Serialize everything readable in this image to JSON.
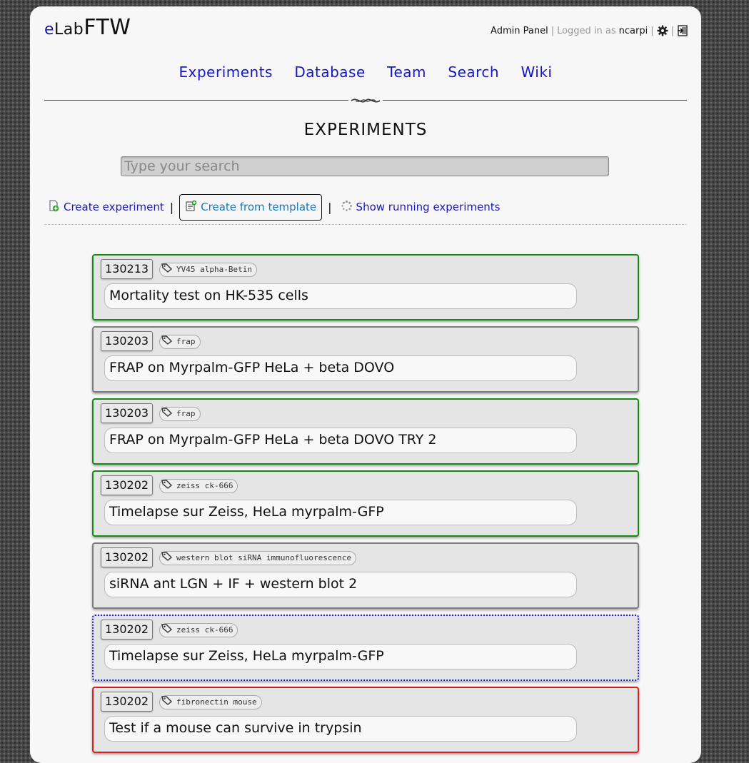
{
  "header": {
    "logo_e": "e",
    "logo_lab": "Lab",
    "logo_ftw": "FTW",
    "admin_panel": "Admin Panel",
    "logged_in_as": "Logged in as",
    "username": "ncarpi"
  },
  "nav": [
    "Experiments",
    "Database",
    "Team",
    "Search",
    "Wiki"
  ],
  "page_title": "EXPERIMENTS",
  "search": {
    "placeholder": "Type your search"
  },
  "actions": {
    "create": "Create experiment",
    "template": "Create from template",
    "running": "Show running experiments"
  },
  "colors": {
    "green": "#138a13",
    "grey": "#7c7c7c",
    "blue": "#1a1ac8",
    "red": "#d81e1e",
    "link": "#1616c8"
  },
  "experiments": [
    {
      "date": "130213",
      "tags": "YV45 alpha-Betin",
      "title": "Mortality test on HK-535 cells",
      "status": "green"
    },
    {
      "date": "130203",
      "tags": "frap",
      "title": "FRAP on Myrpalm-GFP HeLa + beta DOVO",
      "status": "grey"
    },
    {
      "date": "130203",
      "tags": "frap",
      "title": "FRAP on Myrpalm-GFP HeLa + beta DOVO TRY 2",
      "status": "green"
    },
    {
      "date": "130202",
      "tags": "zeiss ck-666",
      "title": "Timelapse sur Zeiss, HeLa myrpalm-GFP",
      "status": "green"
    },
    {
      "date": "130202",
      "tags": "western blot siRNA immunofluorescence",
      "title": "siRNA ant LGN + IF + western blot 2",
      "status": "grey"
    },
    {
      "date": "130202",
      "tags": "zeiss ck-666",
      "title": "Timelapse sur Zeiss, HeLa myrpalm-GFP",
      "status": "blue"
    },
    {
      "date": "130202",
      "tags": "fibronectin mouse",
      "title": "Test if a mouse can survive in trypsin",
      "status": "red"
    }
  ]
}
